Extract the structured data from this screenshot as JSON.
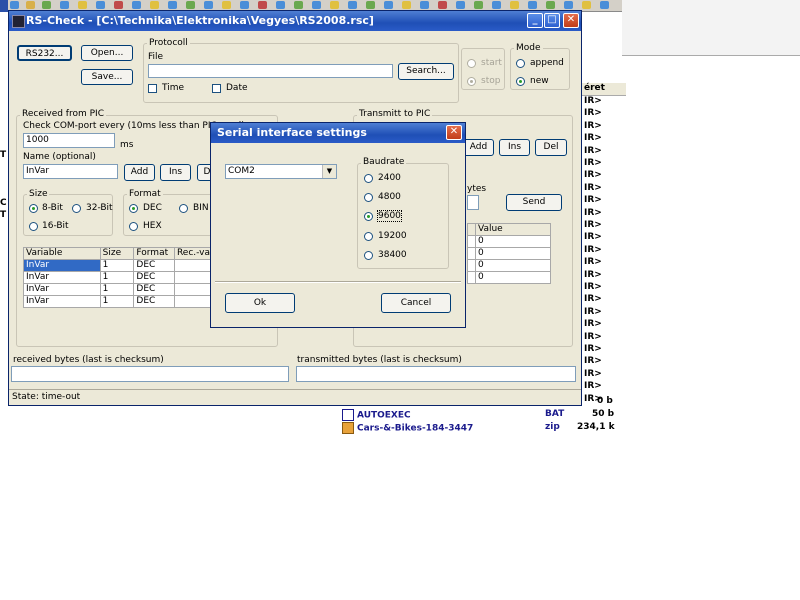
{
  "main_window": {
    "title": "RS-Check - [C:\\Technika\\Elektronika\\Vegyes\\RS2008.rsc]",
    "buttons": {
      "rs232": "RS232...",
      "open": "Open...",
      "save": "Save..."
    },
    "protocol": {
      "group_label": "Protocoll",
      "file_label": "File",
      "file_value": "",
      "search_button": "Search...",
      "time_label": "Time",
      "date_label": "Date",
      "start_label": "start",
      "stop_label": "stop"
    },
    "mode": {
      "group_label": "Mode",
      "append_label": "append",
      "new_label": "new",
      "selected": "new"
    },
    "received": {
      "group_label": "Received from PIC",
      "check_label": "Check COM-port every (10ms less than PIC send)",
      "interval_value": "1000",
      "interval_unit": "ms",
      "name_label": "Name (optional)",
      "name_value": "InVar",
      "add_button": "Add",
      "ins_button": "Ins",
      "del_button_partial": "D",
      "size_group": "Size",
      "size_8": "8-Bit",
      "size_32": "32-Bit",
      "size_16": "16-Bit",
      "format_group": "Format",
      "fmt_dec": "DEC",
      "fmt_bin": "BIN",
      "fmt_hex": "HEX",
      "table_headers": [
        "Variable",
        "Size",
        "Format",
        "Rec.-va"
      ],
      "rows": [
        [
          "InVar",
          "1",
          "DEC",
          ""
        ],
        [
          "InVar",
          "1",
          "DEC",
          ""
        ],
        [
          "InVar",
          "1",
          "DEC",
          ""
        ],
        [
          "InVar",
          "1",
          "DEC",
          ""
        ]
      ]
    },
    "transmit": {
      "group_label": "Transmitt to PIC",
      "add_button": "Add",
      "ins_button": "Ins",
      "del_button": "Del",
      "bytes_label_partial": "ytes",
      "send_button": "Send",
      "value_header": "Value",
      "values": [
        "0",
        "0",
        "0",
        "0"
      ]
    },
    "received_bytes_label": "received bytes (last is checksum)",
    "transmitted_bytes_label": "transmitted bytes (last is checksum)",
    "status": "State: time-out"
  },
  "dialog": {
    "title": "Serial interface settings",
    "port_value": "COM2",
    "baudrate_group": "Baudrate",
    "baud_options": [
      "2400",
      "4800",
      "9600",
      "19200",
      "38400"
    ],
    "baud_selected": "9600",
    "ok_button": "Ok",
    "cancel_button": "Cancel"
  },
  "background": {
    "column_header": "éret",
    "dir_entries": [
      "IR>",
      "IR>",
      "IR>",
      "IR>",
      "IR>",
      "IR>",
      "IR>",
      "IR>",
      "IR>",
      "IR>",
      "IR>",
      "IR>",
      "IR>",
      "IR>",
      "IR>",
      "IR>",
      "IR>",
      "IR>",
      "IR>",
      "IR>",
      "IR>",
      "IR>",
      "IR>",
      "IR>",
      "IR>"
    ],
    "size_0": "0 b",
    "files": [
      {
        "name": "AUTOEXEC",
        "ext": "BAT",
        "size": "50 b"
      },
      {
        "name": "Cars-&-Bikes-184-3447",
        "ext": "zip",
        "size": "234,1 k"
      }
    ],
    "left_stubs": [
      "T",
      "C",
      "T"
    ]
  }
}
